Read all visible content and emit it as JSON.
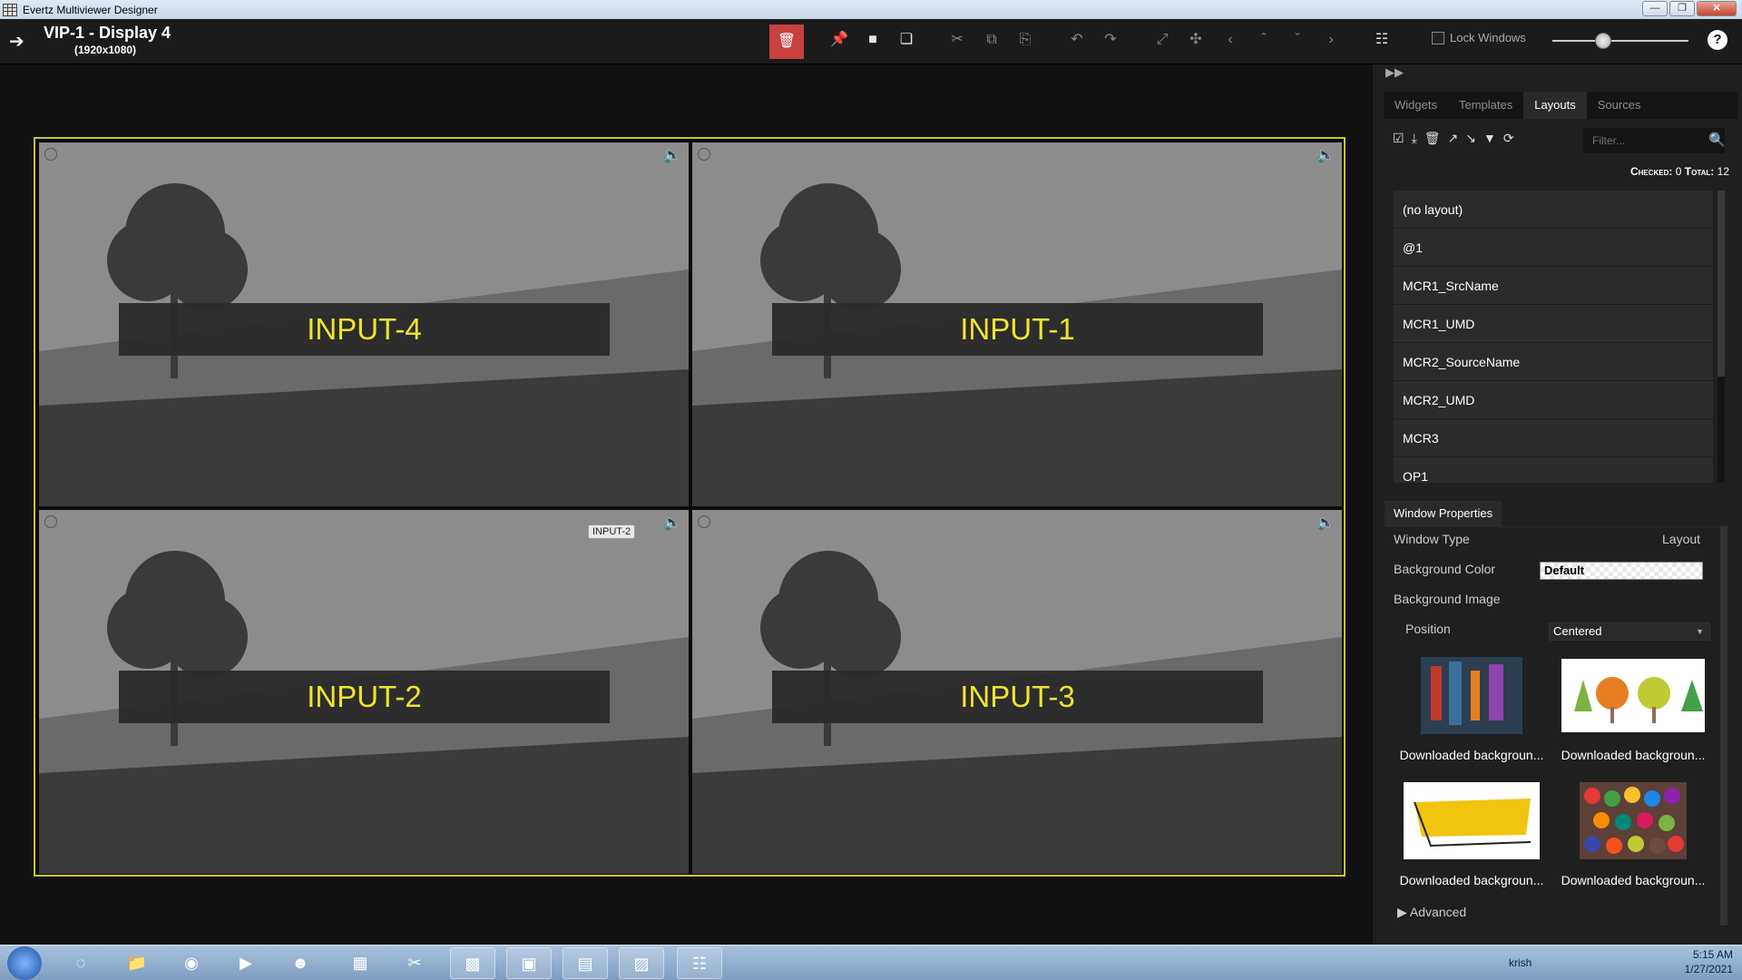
{
  "window": {
    "title": "Evertz Multiviewer Designer",
    "buttons": [
      "—",
      "❐",
      "✕"
    ]
  },
  "toolbar": {
    "display_title": "VIP-1 - Display 4",
    "resolution": "(1920x1080)",
    "lock_label": "Lock Windows",
    "help": "?"
  },
  "canvas": {
    "tiles": [
      {
        "label": "INPUT-4"
      },
      {
        "label": "INPUT-1"
      },
      {
        "label": "INPUT-2",
        "tooltip": "INPUT-2"
      },
      {
        "label": "INPUT-3"
      }
    ]
  },
  "side": {
    "tabs": [
      {
        "label": "Widgets"
      },
      {
        "label": "Templates"
      },
      {
        "label": "Layouts"
      },
      {
        "label": "Sources"
      }
    ],
    "filter_placeholder": "Filter...",
    "checked_label": "Checked:",
    "checked_value": "0",
    "total_label": "Total:",
    "total_value": "12",
    "layouts": [
      {
        "label": "(no layout)"
      },
      {
        "label": "@1"
      },
      {
        "label": "MCR1_SrcName"
      },
      {
        "label": "MCR1_UMD"
      },
      {
        "label": "MCR2_SourceName"
      },
      {
        "label": "MCR2_UMD"
      },
      {
        "label": "MCR3"
      },
      {
        "label": "OP1"
      }
    ],
    "window_properties": {
      "tab": "Window Properties",
      "window_type_label": "Window Type",
      "window_type_value": "Layout",
      "bg_color_label": "Background Color",
      "bg_color_value": "Default",
      "bg_image_label": "Background Image",
      "position_label": "Position",
      "position_value": "Centered",
      "thumbnails": [
        {
          "caption": "Downloaded backgroun..."
        },
        {
          "caption": "Downloaded backgroun..."
        },
        {
          "caption": "Downloaded backgroun..."
        },
        {
          "caption": "Downloaded backgroun..."
        }
      ],
      "advanced_label": "Advanced"
    }
  },
  "taskbar": {
    "user": "krish",
    "time": "5:15 AM",
    "date": "1/27/2021"
  },
  "colors": {
    "accent_yellow": "#f0e42c",
    "frame_border": "#c8c72e",
    "delete_red": "#c9403e"
  }
}
